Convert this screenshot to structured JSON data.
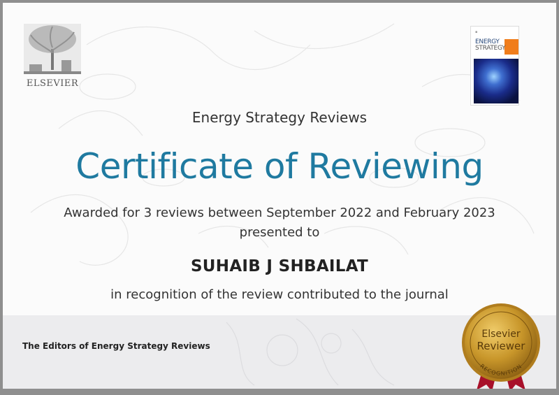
{
  "publisher": {
    "name": "ELSEVIER",
    "logo_icon": "elsevier-tree-icon"
  },
  "journal_cover": {
    "line1": "ENERGY",
    "line2": "STRATEGY",
    "cover_icon": "energy-strategy-reviews-cover"
  },
  "certificate": {
    "journal_name": "Energy Strategy Reviews",
    "title": "Certificate of Reviewing",
    "awarded_line": "Awarded for 3 reviews between September 2022 and February 2023",
    "presented_line": "presented to",
    "recipient": "SUHAIB J SHBAILAT",
    "recognition_line": "in recognition of the review contributed to the journal",
    "signatory": "The Editors of Energy Strategy Reviews"
  },
  "seal": {
    "line1": "Elsevier",
    "line2": "Reviewer",
    "arc_text": "RECOGNITION"
  },
  "colors": {
    "title_blue": "#1f7aa0",
    "seal_gold": "#c8962a",
    "ribbon_red": "#a8102a",
    "cover_orange": "#f07d1b"
  }
}
